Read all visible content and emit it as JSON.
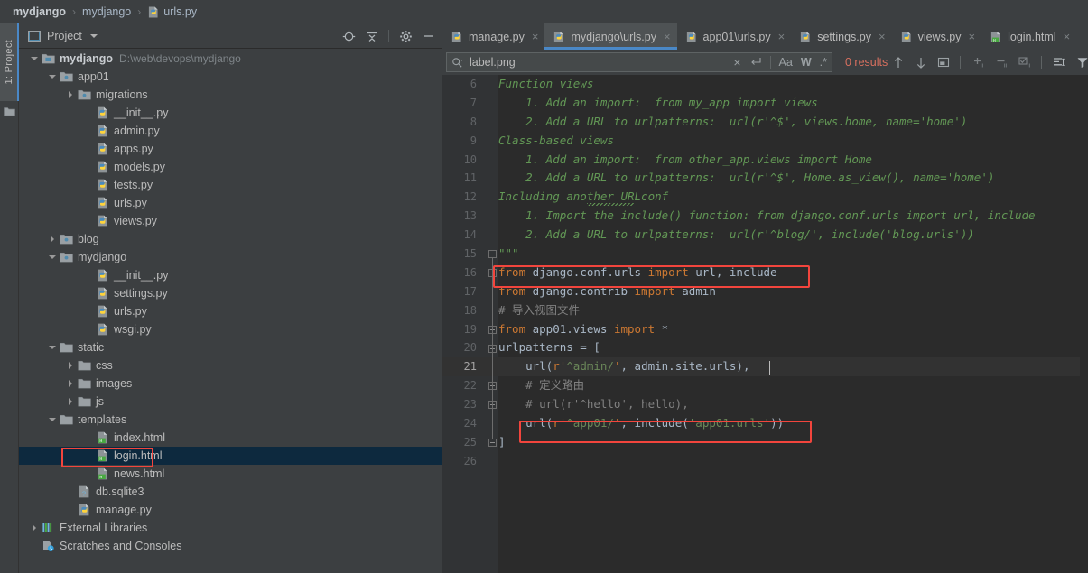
{
  "breadcrumb": {
    "items": [
      {
        "label": "mydjango",
        "strong": true,
        "icon": null
      },
      {
        "label": "mydjango",
        "strong": false,
        "icon": null
      },
      {
        "label": "urls.py",
        "strong": false,
        "icon": "python-file-icon"
      }
    ],
    "separator": "›"
  },
  "left_strip": {
    "tab_label": "1: Project",
    "icon": "folder-icon"
  },
  "project_panel": {
    "title": "Project",
    "header_icons": [
      "locate-icon",
      "collapse-all-icon",
      "settings-gear-icon",
      "hide-panel-icon"
    ],
    "tree": [
      {
        "depth": 0,
        "arrow": "down",
        "icon": "module-folder-icon",
        "label": "mydjango",
        "bold": true,
        "path": "D:\\web\\devops\\mydjango",
        "selected": false
      },
      {
        "depth": 1,
        "arrow": "down",
        "icon": "source-folder-icon",
        "label": "app01",
        "bold": false,
        "path": "",
        "selected": false
      },
      {
        "depth": 2,
        "arrow": "right",
        "icon": "source-folder-icon",
        "label": "migrations",
        "bold": false,
        "path": "",
        "selected": false
      },
      {
        "depth": 3,
        "arrow": "none",
        "icon": "python-file-icon",
        "label": "__init__.py",
        "bold": false,
        "path": "",
        "selected": false
      },
      {
        "depth": 3,
        "arrow": "none",
        "icon": "python-file-icon",
        "label": "admin.py",
        "bold": false,
        "path": "",
        "selected": false
      },
      {
        "depth": 3,
        "arrow": "none",
        "icon": "python-file-icon",
        "label": "apps.py",
        "bold": false,
        "path": "",
        "selected": false
      },
      {
        "depth": 3,
        "arrow": "none",
        "icon": "python-file-icon",
        "label": "models.py",
        "bold": false,
        "path": "",
        "selected": false
      },
      {
        "depth": 3,
        "arrow": "none",
        "icon": "python-file-icon",
        "label": "tests.py",
        "bold": false,
        "path": "",
        "selected": false
      },
      {
        "depth": 3,
        "arrow": "none",
        "icon": "python-file-icon",
        "label": "urls.py",
        "bold": false,
        "path": "",
        "selected": false
      },
      {
        "depth": 3,
        "arrow": "none",
        "icon": "python-file-icon",
        "label": "views.py",
        "bold": false,
        "path": "",
        "selected": false
      },
      {
        "depth": 1,
        "arrow": "right",
        "icon": "source-folder-icon",
        "label": "blog",
        "bold": false,
        "path": "",
        "selected": false
      },
      {
        "depth": 1,
        "arrow": "down",
        "icon": "source-folder-icon",
        "label": "mydjango",
        "bold": false,
        "path": "",
        "selected": false
      },
      {
        "depth": 3,
        "arrow": "none",
        "icon": "python-file-icon",
        "label": "__init__.py",
        "bold": false,
        "path": "",
        "selected": false
      },
      {
        "depth": 3,
        "arrow": "none",
        "icon": "python-file-icon",
        "label": "settings.py",
        "bold": false,
        "path": "",
        "selected": false
      },
      {
        "depth": 3,
        "arrow": "none",
        "icon": "python-file-icon",
        "label": "urls.py",
        "bold": false,
        "path": "",
        "selected": false
      },
      {
        "depth": 3,
        "arrow": "none",
        "icon": "python-file-icon",
        "label": "wsgi.py",
        "bold": false,
        "path": "",
        "selected": false
      },
      {
        "depth": 1,
        "arrow": "down",
        "icon": "folder-icon",
        "label": "static",
        "bold": false,
        "path": "",
        "selected": false
      },
      {
        "depth": 2,
        "arrow": "right",
        "icon": "folder-icon",
        "label": "css",
        "bold": false,
        "path": "",
        "selected": false
      },
      {
        "depth": 2,
        "arrow": "right",
        "icon": "folder-icon",
        "label": "images",
        "bold": false,
        "path": "",
        "selected": false
      },
      {
        "depth": 2,
        "arrow": "right",
        "icon": "folder-icon",
        "label": "js",
        "bold": false,
        "path": "",
        "selected": false
      },
      {
        "depth": 1,
        "arrow": "down",
        "icon": "folder-icon",
        "label": "templates",
        "bold": false,
        "path": "",
        "selected": false
      },
      {
        "depth": 3,
        "arrow": "none",
        "icon": "html-file-icon",
        "label": "index.html",
        "bold": false,
        "path": "",
        "selected": false
      },
      {
        "depth": 3,
        "arrow": "none",
        "icon": "html-file-icon",
        "label": "login.html",
        "bold": false,
        "path": "",
        "selected": true
      },
      {
        "depth": 3,
        "arrow": "none",
        "icon": "html-file-icon",
        "label": "news.html",
        "bold": false,
        "path": "",
        "selected": false
      },
      {
        "depth": 2,
        "arrow": "none",
        "icon": "sqlite-file-icon",
        "label": "db.sqlite3",
        "bold": false,
        "path": "",
        "selected": false
      },
      {
        "depth": 2,
        "arrow": "none",
        "icon": "python-file-icon",
        "label": "manage.py",
        "bold": false,
        "path": "",
        "selected": false
      },
      {
        "depth": 0,
        "arrow": "right",
        "icon": "library-icon",
        "label": "External Libraries",
        "bold": false,
        "path": "",
        "selected": false
      },
      {
        "depth": 0,
        "arrow": "none",
        "icon": "scratches-icon",
        "label": "Scratches and Consoles",
        "bold": false,
        "path": "",
        "selected": false
      }
    ],
    "highlight_label": "login.html"
  },
  "editor_tabs": [
    {
      "label": "manage.py",
      "icon": "python-file-icon",
      "active": false,
      "close": "×"
    },
    {
      "label": "mydjango\\urls.py",
      "icon": "python-file-icon",
      "active": true,
      "close": "×"
    },
    {
      "label": "app01\\urls.py",
      "icon": "python-file-icon",
      "active": false,
      "close": "×"
    },
    {
      "label": "settings.py",
      "icon": "python-file-icon",
      "active": false,
      "close": "×"
    },
    {
      "label": "views.py",
      "icon": "python-file-icon",
      "active": false,
      "close": "×"
    },
    {
      "label": "login.html",
      "icon": "html-file-icon",
      "active": false,
      "close": "×"
    }
  ],
  "find_bar": {
    "search_icon": "search-dropdown-icon",
    "query": "label.png",
    "clear_label": "×",
    "regex_history_icon": "new-line-icon",
    "match_case_label": "Aa",
    "words_label": "W",
    "regex_label": ".*",
    "results_text": "0 results",
    "prev_icon": "arrow-up-icon",
    "next_icon": "arrow-down-icon",
    "select_all_icon": "open-in-window-icon",
    "add_icon": "add-occurrence-icon",
    "remove_icon": "remove-occurrence-icon",
    "select_occurrence_icon": "select-all-occurrences-icon",
    "preserve_case_icon": "in-selection-icon",
    "filter_icon": "filter-icon"
  },
  "code": {
    "first_line": 6,
    "current_line": 21,
    "lines": [
      {
        "n": 6,
        "tokens": [
          {
            "t": "doc",
            "s": "Function views"
          }
        ]
      },
      {
        "n": 7,
        "tokens": [
          {
            "t": "doc",
            "s": "    1. Add an import:  from my_app import views"
          }
        ]
      },
      {
        "n": 8,
        "tokens": [
          {
            "t": "doc",
            "s": "    2. Add a URL to urlpatterns:  url(r'^$', views.home, name='home')"
          }
        ]
      },
      {
        "n": 9,
        "tokens": [
          {
            "t": "doc",
            "s": "Class-based views"
          }
        ]
      },
      {
        "n": 10,
        "tokens": [
          {
            "t": "doc",
            "s": "    1. Add an import:  from other_app.views import Home"
          }
        ]
      },
      {
        "n": 11,
        "tokens": [
          {
            "t": "doc",
            "s": "    2. Add a URL to urlpatterns:  url(r'^$', Home.as_view(), name='home')"
          }
        ]
      },
      {
        "n": 12,
        "tokens": [
          {
            "t": "doc",
            "s": "Including another URLconf"
          }
        ]
      },
      {
        "n": 13,
        "tokens": [
          {
            "t": "doc",
            "s": "    1. Import the include() function: from django.conf.urls import url, include"
          }
        ]
      },
      {
        "n": 14,
        "tokens": [
          {
            "t": "doc",
            "s": "    2. Add a URL to urlpatterns:  url(r'^blog/', include('blog.urls'))"
          }
        ]
      },
      {
        "n": 15,
        "tokens": [
          {
            "t": "doc",
            "s": "\"\"\""
          }
        ]
      },
      {
        "n": 16,
        "tokens": [
          {
            "t": "kw",
            "s": "from"
          },
          {
            "t": "plain",
            "s": " django.conf.urls "
          },
          {
            "t": "kw",
            "s": "import"
          },
          {
            "t": "plain",
            "s": " url, include"
          }
        ]
      },
      {
        "n": 17,
        "tokens": [
          {
            "t": "kw",
            "s": "from"
          },
          {
            "t": "plain",
            "s": " django.contrib "
          },
          {
            "t": "kw",
            "s": "import"
          },
          {
            "t": "plain",
            "s": " admin"
          }
        ]
      },
      {
        "n": 18,
        "tokens": [
          {
            "t": "cmt",
            "s": "# 导入视图文件"
          }
        ]
      },
      {
        "n": 19,
        "tokens": [
          {
            "t": "kw",
            "s": "from"
          },
          {
            "t": "plain",
            "s": " app01.views "
          },
          {
            "t": "kw",
            "s": "import"
          },
          {
            "t": "plain",
            "s": " *"
          }
        ]
      },
      {
        "n": 20,
        "tokens": [
          {
            "t": "plain",
            "s": "urlpatterns = ["
          }
        ]
      },
      {
        "n": 21,
        "tokens": [
          {
            "t": "plain",
            "s": "    url("
          },
          {
            "t": "kw",
            "s": "r'"
          },
          {
            "t": "str",
            "s": "^admin/"
          },
          {
            "t": "kw",
            "s": "'"
          },
          {
            "t": "plain",
            "s": ", admin.site.urls),"
          }
        ]
      },
      {
        "n": 22,
        "tokens": [
          {
            "t": "cmt",
            "s": "    # 定义路由"
          }
        ]
      },
      {
        "n": 23,
        "tokens": [
          {
            "t": "cmt",
            "s": "    # url(r'^hello', hello),"
          }
        ]
      },
      {
        "n": 24,
        "tokens": [
          {
            "t": "plain",
            "s": "    url("
          },
          {
            "t": "kw",
            "s": "r'"
          },
          {
            "t": "str",
            "s": "^app01/"
          },
          {
            "t": "kw",
            "s": "'"
          },
          {
            "t": "plain",
            "s": ", include("
          },
          {
            "t": "str",
            "s": "'app01.urls'"
          },
          {
            "t": "plain",
            "s": "))"
          }
        ]
      },
      {
        "n": 25,
        "tokens": [
          {
            "t": "plain",
            "s": "]"
          }
        ]
      },
      {
        "n": 26,
        "tokens": [
          {
            "t": "plain",
            "s": ""
          }
        ]
      }
    ],
    "highlighted_lines": [
      16,
      24
    ]
  },
  "colors": {
    "accent": "#4a88c7",
    "highlight_box": "#f2453d",
    "selection": "#0d293e",
    "editor_bg": "#2b2b2b",
    "panel_bg": "#3c3f41",
    "gutter_bg": "#313335",
    "doc_green": "#629755",
    "keyword_orange": "#cc7832",
    "string_green": "#6a8759",
    "comment_gray": "#808080",
    "text": "#a9b7c6",
    "results_red": "#d9705f"
  }
}
